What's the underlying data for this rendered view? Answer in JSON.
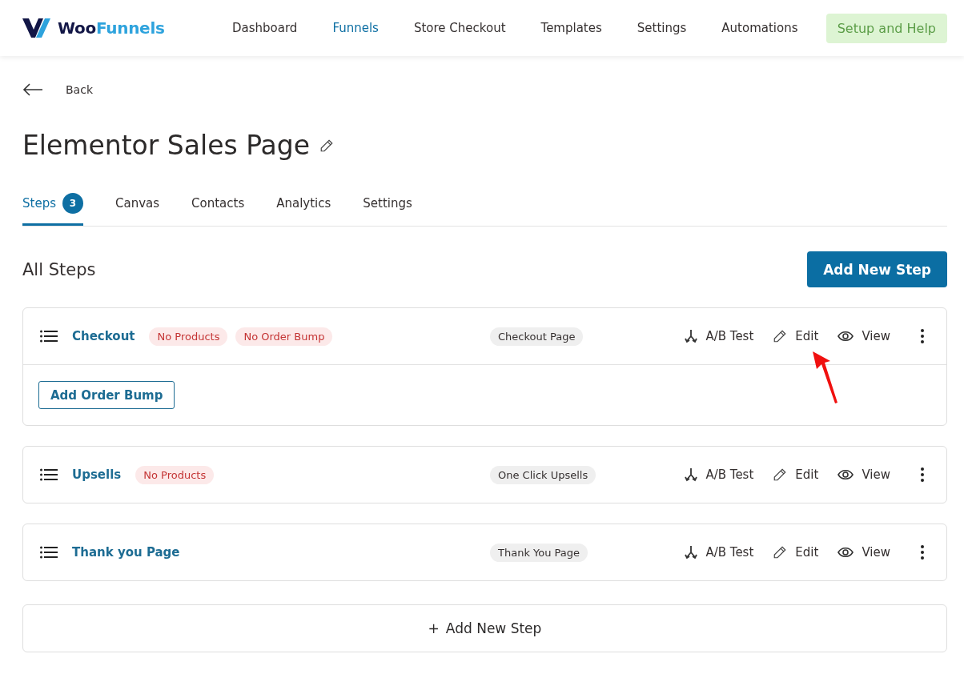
{
  "logo": {
    "parts": [
      "Woo",
      "Funnels"
    ]
  },
  "nav": [
    {
      "label": "Dashboard",
      "selected": false
    },
    {
      "label": "Funnels",
      "selected": true
    },
    {
      "label": "Store Checkout",
      "selected": false
    },
    {
      "label": "Templates",
      "selected": false
    },
    {
      "label": "Settings",
      "selected": false
    },
    {
      "label": "Automations",
      "selected": false
    }
  ],
  "help_button": "Setup and Help",
  "back": "Back",
  "title": "Elementor Sales Page",
  "tabs": [
    {
      "label": "Steps",
      "badge": "3",
      "selected": true
    },
    {
      "label": "Canvas",
      "selected": false
    },
    {
      "label": "Contacts",
      "selected": false
    },
    {
      "label": "Analytics",
      "selected": false
    },
    {
      "label": "Settings",
      "selected": false
    }
  ],
  "section_title": "All Steps",
  "add_button": "Add New Step",
  "steps": [
    {
      "name": "Checkout",
      "tags": [
        "No Products",
        "No Order Bump"
      ],
      "type": "Checkout Page",
      "actions": [
        "A/B Test",
        "Edit",
        "View"
      ],
      "footer_button": "Add Order Bump",
      "pointer": true
    },
    {
      "name": "Upsells",
      "tags": [
        "No Products"
      ],
      "type": "One Click Upsells",
      "actions": [
        "A/B Test",
        "Edit",
        "View"
      ],
      "pointer": false
    },
    {
      "name": "Thank you Page",
      "type": "Thank You Page",
      "actions": [
        "A/B Test",
        "Edit",
        "View"
      ],
      "pointer": false
    }
  ],
  "add_step_bar": {
    "icon": "+",
    "label": "Add New Step"
  }
}
